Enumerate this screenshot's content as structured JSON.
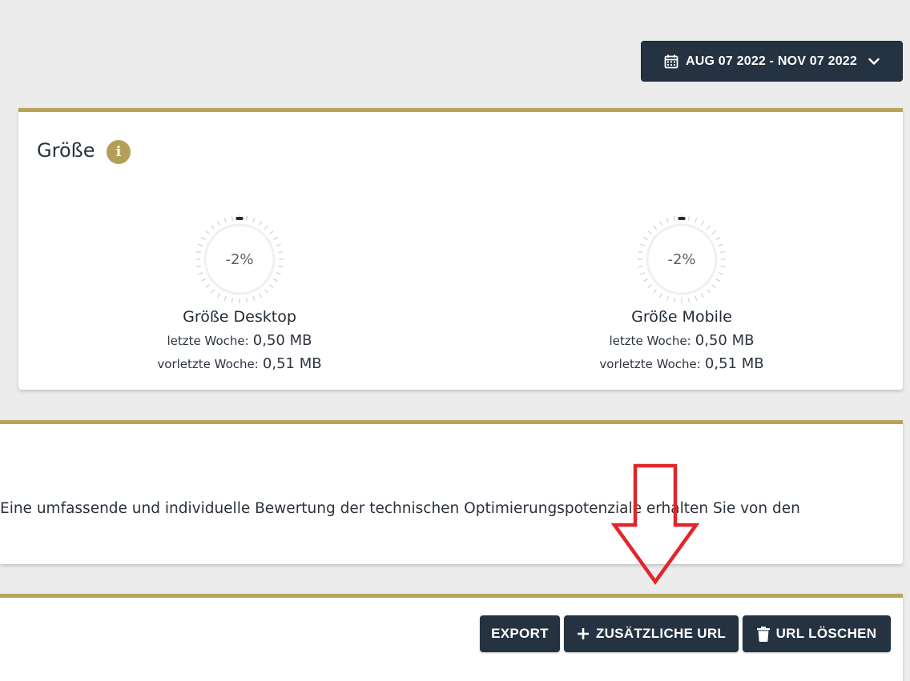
{
  "date_range": {
    "label": "AUG 07 2022 - NOV 07 2022"
  },
  "size_card": {
    "title": "Größe",
    "desktop": {
      "title": "Größe Desktop",
      "change": "-2%",
      "last_week_label": "letzte Woche:",
      "last_week_value": "0,50 MB",
      "prev_week_label": "vorletzte Woche:",
      "prev_week_value": "0,51 MB"
    },
    "mobile": {
      "title": "Größe Mobile",
      "change": "-2%",
      "last_week_label": "letzte Woche:",
      "last_week_value": "0,50 MB",
      "prev_week_label": "vorletzte Woche:",
      "prev_week_value": "0,51 MB"
    }
  },
  "info_card": {
    "text": "Eine umfassende und individuelle Bewertung der technischen Optimierungspotenziale erhalten Sie von den"
  },
  "url_toolbar": {
    "export_label": "EXPORT",
    "add_label": "ZUSÄTZLICHE URL",
    "delete_label": "URL LÖSCHEN"
  },
  "colors": {
    "accent": "#b8a35a",
    "button": "#253241",
    "annotation": "#e0262c"
  },
  "icons": [
    "calendar-icon",
    "chevron-down-icon",
    "info-icon",
    "plus-icon",
    "trash-icon",
    "arrow-down-annotation"
  ]
}
